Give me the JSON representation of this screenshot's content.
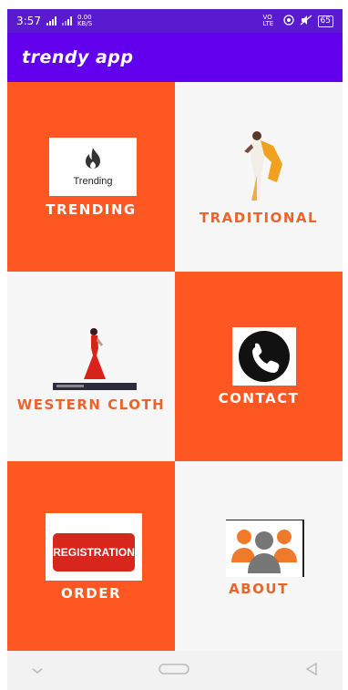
{
  "status_bar": {
    "time": "3:57",
    "data_rate": "0.00",
    "data_unit": "KB/S",
    "volte": "VO LTE",
    "battery": "65"
  },
  "app_bar": {
    "title": "trendy app"
  },
  "tiles": {
    "trending": {
      "label": "TRENDING",
      "logo_text": "Trending",
      "icon": "flame-icon"
    },
    "traditional": {
      "label": "TRADITIONAL",
      "icon": "saree-model-image"
    },
    "western": {
      "label": "WESTERN CLOTH",
      "icon": "gown-model-image"
    },
    "contact": {
      "label": "CONTACT",
      "icon": "phone-icon"
    },
    "order": {
      "label": "ORDER",
      "button_text": "REGISTRATION"
    },
    "about": {
      "label": "ABOUT",
      "icon": "people-icon"
    }
  },
  "colors": {
    "app_bar": "#6200ee",
    "status_bar": "#5a1bd0",
    "tile_orange": "#ff5722",
    "tile_white": "#f7f7f7",
    "label_orange": "#e9652b",
    "registration_red": "#d9261c"
  },
  "nav": {
    "icons": [
      "chevron-down-icon",
      "home-pill-icon",
      "back-triangle-icon"
    ]
  }
}
